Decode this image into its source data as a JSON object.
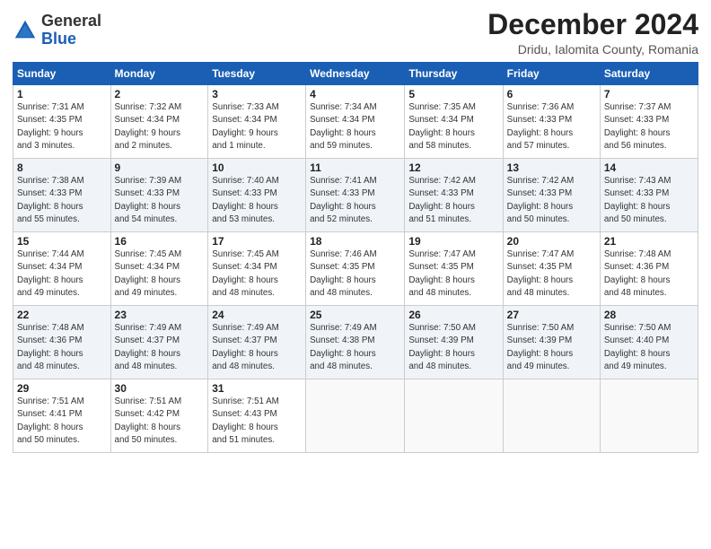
{
  "header": {
    "logo_general": "General",
    "logo_blue": "Blue",
    "month_title": "December 2024",
    "location": "Dridu, Ialomita County, Romania"
  },
  "calendar": {
    "days_of_week": [
      "Sunday",
      "Monday",
      "Tuesday",
      "Wednesday",
      "Thursday",
      "Friday",
      "Saturday"
    ],
    "weeks": [
      [
        {
          "day": "1",
          "info": "Sunrise: 7:31 AM\nSunset: 4:35 PM\nDaylight: 9 hours\nand 3 minutes."
        },
        {
          "day": "2",
          "info": "Sunrise: 7:32 AM\nSunset: 4:34 PM\nDaylight: 9 hours\nand 2 minutes."
        },
        {
          "day": "3",
          "info": "Sunrise: 7:33 AM\nSunset: 4:34 PM\nDaylight: 9 hours\nand 1 minute."
        },
        {
          "day": "4",
          "info": "Sunrise: 7:34 AM\nSunset: 4:34 PM\nDaylight: 8 hours\nand 59 minutes."
        },
        {
          "day": "5",
          "info": "Sunrise: 7:35 AM\nSunset: 4:34 PM\nDaylight: 8 hours\nand 58 minutes."
        },
        {
          "day": "6",
          "info": "Sunrise: 7:36 AM\nSunset: 4:33 PM\nDaylight: 8 hours\nand 57 minutes."
        },
        {
          "day": "7",
          "info": "Sunrise: 7:37 AM\nSunset: 4:33 PM\nDaylight: 8 hours\nand 56 minutes."
        }
      ],
      [
        {
          "day": "8",
          "info": "Sunrise: 7:38 AM\nSunset: 4:33 PM\nDaylight: 8 hours\nand 55 minutes."
        },
        {
          "day": "9",
          "info": "Sunrise: 7:39 AM\nSunset: 4:33 PM\nDaylight: 8 hours\nand 54 minutes."
        },
        {
          "day": "10",
          "info": "Sunrise: 7:40 AM\nSunset: 4:33 PM\nDaylight: 8 hours\nand 53 minutes."
        },
        {
          "day": "11",
          "info": "Sunrise: 7:41 AM\nSunset: 4:33 PM\nDaylight: 8 hours\nand 52 minutes."
        },
        {
          "day": "12",
          "info": "Sunrise: 7:42 AM\nSunset: 4:33 PM\nDaylight: 8 hours\nand 51 minutes."
        },
        {
          "day": "13",
          "info": "Sunrise: 7:42 AM\nSunset: 4:33 PM\nDaylight: 8 hours\nand 50 minutes."
        },
        {
          "day": "14",
          "info": "Sunrise: 7:43 AM\nSunset: 4:33 PM\nDaylight: 8 hours\nand 50 minutes."
        }
      ],
      [
        {
          "day": "15",
          "info": "Sunrise: 7:44 AM\nSunset: 4:34 PM\nDaylight: 8 hours\nand 49 minutes."
        },
        {
          "day": "16",
          "info": "Sunrise: 7:45 AM\nSunset: 4:34 PM\nDaylight: 8 hours\nand 49 minutes."
        },
        {
          "day": "17",
          "info": "Sunrise: 7:45 AM\nSunset: 4:34 PM\nDaylight: 8 hours\nand 48 minutes."
        },
        {
          "day": "18",
          "info": "Sunrise: 7:46 AM\nSunset: 4:35 PM\nDaylight: 8 hours\nand 48 minutes."
        },
        {
          "day": "19",
          "info": "Sunrise: 7:47 AM\nSunset: 4:35 PM\nDaylight: 8 hours\nand 48 minutes."
        },
        {
          "day": "20",
          "info": "Sunrise: 7:47 AM\nSunset: 4:35 PM\nDaylight: 8 hours\nand 48 minutes."
        },
        {
          "day": "21",
          "info": "Sunrise: 7:48 AM\nSunset: 4:36 PM\nDaylight: 8 hours\nand 48 minutes."
        }
      ],
      [
        {
          "day": "22",
          "info": "Sunrise: 7:48 AM\nSunset: 4:36 PM\nDaylight: 8 hours\nand 48 minutes."
        },
        {
          "day": "23",
          "info": "Sunrise: 7:49 AM\nSunset: 4:37 PM\nDaylight: 8 hours\nand 48 minutes."
        },
        {
          "day": "24",
          "info": "Sunrise: 7:49 AM\nSunset: 4:37 PM\nDaylight: 8 hours\nand 48 minutes."
        },
        {
          "day": "25",
          "info": "Sunrise: 7:49 AM\nSunset: 4:38 PM\nDaylight: 8 hours\nand 48 minutes."
        },
        {
          "day": "26",
          "info": "Sunrise: 7:50 AM\nSunset: 4:39 PM\nDaylight: 8 hours\nand 48 minutes."
        },
        {
          "day": "27",
          "info": "Sunrise: 7:50 AM\nSunset: 4:39 PM\nDaylight: 8 hours\nand 49 minutes."
        },
        {
          "day": "28",
          "info": "Sunrise: 7:50 AM\nSunset: 4:40 PM\nDaylight: 8 hours\nand 49 minutes."
        }
      ],
      [
        {
          "day": "29",
          "info": "Sunrise: 7:51 AM\nSunset: 4:41 PM\nDaylight: 8 hours\nand 50 minutes."
        },
        {
          "day": "30",
          "info": "Sunrise: 7:51 AM\nSunset: 4:42 PM\nDaylight: 8 hours\nand 50 minutes."
        },
        {
          "day": "31",
          "info": "Sunrise: 7:51 AM\nSunset: 4:43 PM\nDaylight: 8 hours\nand 51 minutes."
        },
        {
          "day": "",
          "info": ""
        },
        {
          "day": "",
          "info": ""
        },
        {
          "day": "",
          "info": ""
        },
        {
          "day": "",
          "info": ""
        }
      ]
    ]
  }
}
